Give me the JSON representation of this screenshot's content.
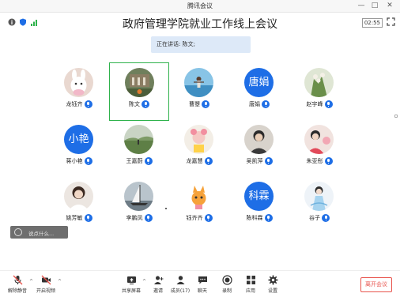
{
  "app_title": "腾讯会议",
  "meeting_title": "政府管理学院就业工作线上会议",
  "clock": "02:55",
  "speaking": "正在讲话: 陈文;",
  "participants": [
    {
      "name": "龙钰齐"
    },
    {
      "name": "陈文"
    },
    {
      "name": "曹曌"
    },
    {
      "name": "唐娟",
      "avatar_text": "唐娟"
    },
    {
      "name": "赵宇峰"
    },
    {
      "name": "蒋小艳",
      "avatar_text": "小艳"
    },
    {
      "name": "王嘉蔚"
    },
    {
      "name": "龙嘉慧"
    },
    {
      "name": "吴凯萍"
    },
    {
      "name": "朱亚彤"
    },
    {
      "name": "姚芳敏"
    },
    {
      "name": "李鹏凤"
    },
    {
      "name": "钰齐齐"
    },
    {
      "name": "陈科霖",
      "avatar_text": "科霖"
    },
    {
      "name": "谷子"
    }
  ],
  "chat_placeholder": "说点什么...",
  "toolbar": {
    "unmute": "解除静音",
    "video": "开启视频",
    "share": "共享屏幕",
    "invite": "邀请",
    "members": "成员(17)",
    "chat": "聊天",
    "record": "录制",
    "apps": "应用",
    "settings": "设置",
    "leave": "离开会议"
  },
  "colors": {
    "accent": "#1e6ee6",
    "active_border": "#2fb24c",
    "leave": "#e8534c",
    "speaking_bg": "#dde9f8"
  }
}
